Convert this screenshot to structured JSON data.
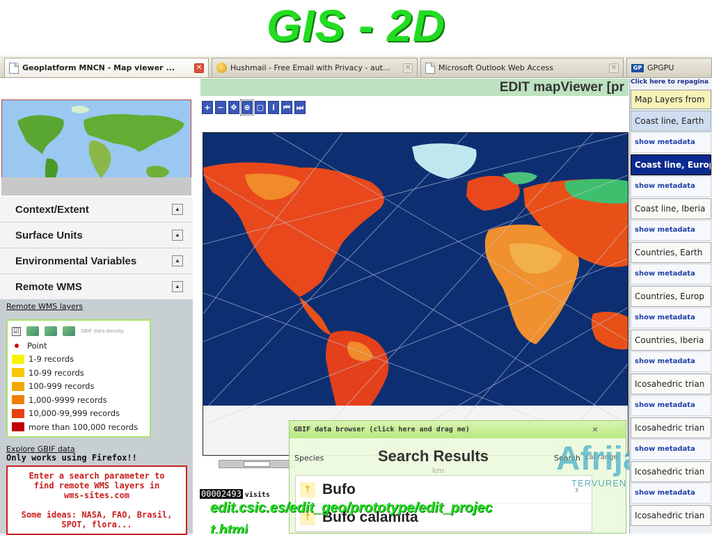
{
  "slide": {
    "title": "GIS  - 2D"
  },
  "browser": {
    "tabs": [
      {
        "label": "Geoplatform MNCN - Map viewer ...",
        "icon": "document-icon",
        "active": true
      },
      {
        "label": "Hushmail - Free Email with Privacy - aut...",
        "icon": "hushmail-icon",
        "active": false
      },
      {
        "label": "Microsoft Outlook Web Access",
        "icon": "document-icon",
        "active": false
      },
      {
        "label": "GPGPU",
        "icon": "gpgpu-icon",
        "active": false
      }
    ],
    "close_glyph": "✕"
  },
  "left": {
    "accordion": [
      {
        "label": "Context/Extent"
      },
      {
        "label": "Surface Units"
      },
      {
        "label": "Environmental Variables"
      },
      {
        "label": "Remote WMS"
      }
    ],
    "collapse_glyph": "▲",
    "remote_wms_link": "Remote WMS layers",
    "legend": {
      "checkbox_glyph": "☑",
      "density_label": "GBIF data density",
      "point_label": "Point",
      "rows": [
        {
          "label": "1-9 records",
          "color": "#f8f400"
        },
        {
          "label": "10-99 records",
          "color": "#f6c800"
        },
        {
          "label": "100-999 records",
          "color": "#f2a800"
        },
        {
          "label": "1,000-9999 records",
          "color": "#ee8000"
        },
        {
          "label": "10,000-99,999 records",
          "color": "#e84010"
        },
        {
          "label": "more than 100,000 records",
          "color": "#c00000"
        }
      ]
    },
    "explore_link": "Explore GBIF data",
    "firefox_note": "Only works using Firefox!!",
    "search_help": {
      "line1": "Enter a search parameter to",
      "line2": "find remote WMS layers in",
      "line3": "wms-sites.com",
      "line4": "Some ideas: NASA, FAO, Brasil,",
      "line5": "SPOT, flora..."
    }
  },
  "map": {
    "header_title": "EDIT mapViewer [pr",
    "toolbar": [
      "+",
      "−",
      "✥",
      "⊕",
      "▢",
      "i",
      "⏮",
      "⏭"
    ],
    "visits_count": "00002493",
    "visits_label": "visits"
  },
  "gbif": {
    "title": "GBIF data browser (click here and drag me)",
    "close": "✕",
    "species_label": "Species",
    "results_title": "Search Results",
    "search_label": "Search",
    "km_label": "km",
    "side_text": "cal range",
    "results": [
      {
        "name": "Bufo"
      },
      {
        "name": "Bufo calamita"
      }
    ],
    "arrow_glyph": "↑",
    "chevron": "›"
  },
  "layers": {
    "repaginate": "Click here to repagina",
    "heading": "Map Layers from",
    "metadata_label": "show metadata",
    "items": [
      {
        "name": "Coast line, Earth",
        "style": "blue"
      },
      {
        "name": "Coast line, Europ",
        "style": "selected"
      },
      {
        "name": "Coast line, Iberia",
        "style": "plain"
      },
      {
        "name": "Countries, Earth",
        "style": "plain"
      },
      {
        "name": "Countries, Europ",
        "style": "plain"
      },
      {
        "name": "Countries, Iberia",
        "style": "plain"
      },
      {
        "name": "Icosahedric trian",
        "style": "plain"
      },
      {
        "name": "Icosahedric trian",
        "style": "plain"
      },
      {
        "name": "Icosahedric trian",
        "style": "plain"
      },
      {
        "name": "Icosahedric trian",
        "style": "plain"
      }
    ]
  },
  "caption": {
    "url_line1": "edit.csic.es/edit_geo/prototype/edit_projec",
    "url_line2": "t.html"
  },
  "logo": {
    "text": "Afrija",
    "subtext": "TERVUREN"
  },
  "colors": {
    "title_green": "#22dd22",
    "ocean": "#0d2f72",
    "land_hot": "#e0401a",
    "land_warm": "#f08a2a",
    "layer_link": "#2040a8"
  }
}
